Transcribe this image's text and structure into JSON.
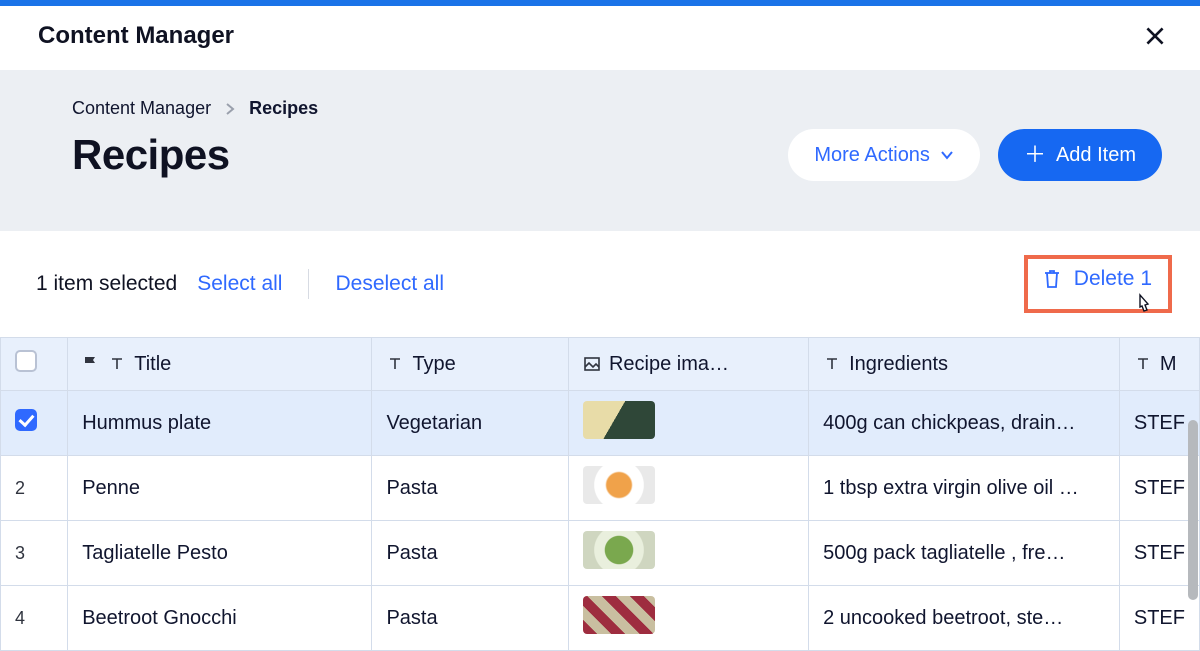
{
  "header": {
    "title": "Content Manager"
  },
  "breadcrumb": {
    "root": "Content Manager",
    "current": "Recipes"
  },
  "page": {
    "title": "Recipes"
  },
  "actions": {
    "more": "More Actions",
    "add": "Add Item"
  },
  "selection": {
    "count_text": "1 item selected",
    "select_all": "Select all",
    "deselect_all": "Deselect all",
    "delete_label": "Delete 1"
  },
  "columns": {
    "title": "Title",
    "type": "Type",
    "image": "Recipe ima…",
    "ingredients": "Ingredients",
    "last": "M"
  },
  "rows": [
    {
      "selected": true,
      "num": "",
      "title": "Hummus plate",
      "type": "Vegetarian",
      "thumb": "thumb1",
      "ingredients": "400g can chickpeas, drain…",
      "last": "STEF"
    },
    {
      "selected": false,
      "num": "2",
      "title": "Penne",
      "type": "Pasta",
      "thumb": "thumb2",
      "ingredients": "1 tbsp extra virgin olive oil …",
      "last": "STEF"
    },
    {
      "selected": false,
      "num": "3",
      "title": "Tagliatelle Pesto",
      "type": "Pasta",
      "thumb": "thumb3",
      "ingredients": "500g pack tagliatelle , fre…",
      "last": "STEF"
    },
    {
      "selected": false,
      "num": "4",
      "title": "Beetroot Gnocchi",
      "type": "Pasta",
      "thumb": "thumb4",
      "ingredients": "2 uncooked beetroot, ste…",
      "last": "STEF"
    }
  ]
}
